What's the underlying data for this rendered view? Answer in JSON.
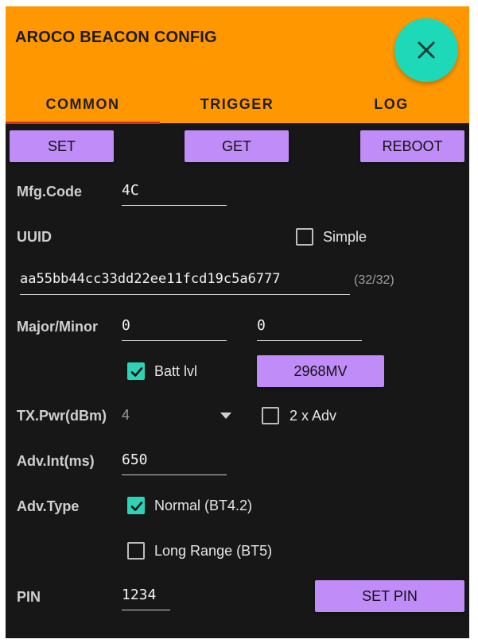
{
  "app": {
    "title": "AROCO BEACON CONFIG",
    "accent_color": "#ff9800",
    "fab_color": "#1dd9b8",
    "button_color": "#c08cf8"
  },
  "fab": {
    "icon": "close-icon"
  },
  "tabs": [
    {
      "label": "COMMON",
      "selected": true
    },
    {
      "label": "TRIGGER",
      "selected": false
    },
    {
      "label": "LOG",
      "selected": false
    }
  ],
  "toolbar": {
    "set_label": "SET",
    "get_label": "GET",
    "reboot_label": "REBOOT"
  },
  "form": {
    "mfg_code_label": "Mfg.Code",
    "mfg_code_value": "4C",
    "uuid_label": "UUID",
    "simple_label": "Simple",
    "simple_checked": false,
    "uuid_value": "aa55bb44cc33dd22ee11fcd19c5a6777",
    "uuid_counter": "(32/32)",
    "major_minor_label": "Major/Minor",
    "major_value": "0",
    "minor_value": "0",
    "batt_label": "Batt lvl",
    "batt_checked": true,
    "batt_button_label": "2968MV",
    "txpwr_label": "TX.Pwr(dBm)",
    "txpwr_value": "4",
    "double_adv_label": "2 x Adv",
    "double_adv_checked": false,
    "adv_int_label": "Adv.Int(ms)",
    "adv_int_value": "650",
    "adv_type_label": "Adv.Type",
    "normal_label": "Normal (BT4.2)",
    "normal_checked": true,
    "long_range_label": "Long Range (BT5)",
    "long_range_checked": false,
    "pin_label": "PIN",
    "pin_value": "1234",
    "set_pin_label": "SET PIN"
  }
}
